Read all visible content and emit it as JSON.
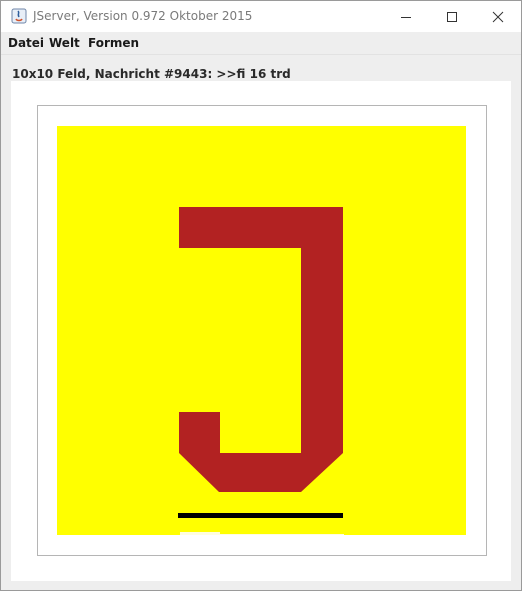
{
  "window": {
    "title": "JServer, Version 0.972 Oktober 2015",
    "icon": "java-app-icon",
    "controls": [
      "minimize-icon",
      "maximize-icon",
      "close-icon"
    ]
  },
  "menubar": {
    "items": [
      "Datei",
      "Welt",
      "Formen"
    ]
  },
  "status": {
    "text": "10x10 Feld, Nachricht #9443: >>fi 16 trd"
  },
  "board": {
    "rows": 10,
    "cols": 10,
    "background_color": "#ffff00",
    "shape_color": "#b22222",
    "underline_color": "#000000",
    "shape": "letter-J"
  }
}
